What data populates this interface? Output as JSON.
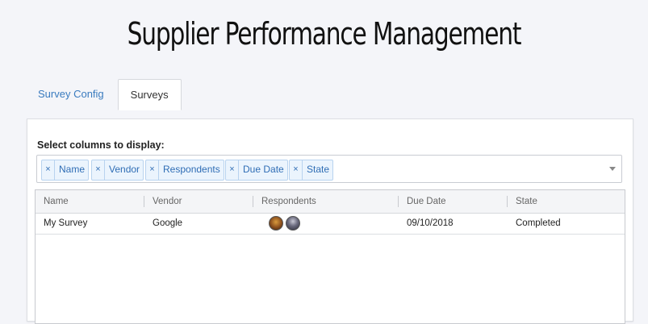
{
  "page": {
    "title": "Supplier Performance Management"
  },
  "tabs": [
    {
      "label": "Survey Config",
      "active": false
    },
    {
      "label": "Surveys",
      "active": true
    }
  ],
  "column_selector": {
    "label": "Select columns to display:",
    "remove_glyph": "×",
    "chips": [
      "Name",
      "Vendor",
      "Respondents",
      "Due Date",
      "State"
    ]
  },
  "table": {
    "headers": [
      "Name",
      "Vendor",
      "Respondents",
      "Due Date",
      "State"
    ],
    "rows": [
      {
        "name": "My Survey",
        "vendor": "Google",
        "respondents": [
          "avatar-1",
          "avatar-2"
        ],
        "due_date": "09/10/2018",
        "state": "Completed"
      }
    ]
  },
  "colors": {
    "accent": "#3a7bbf",
    "chip_bg": "#ebf4fd",
    "chip_border": "#b8d3ef"
  },
  "icons": {
    "dropdown": "chevron-down-icon",
    "remove": "close-icon"
  }
}
